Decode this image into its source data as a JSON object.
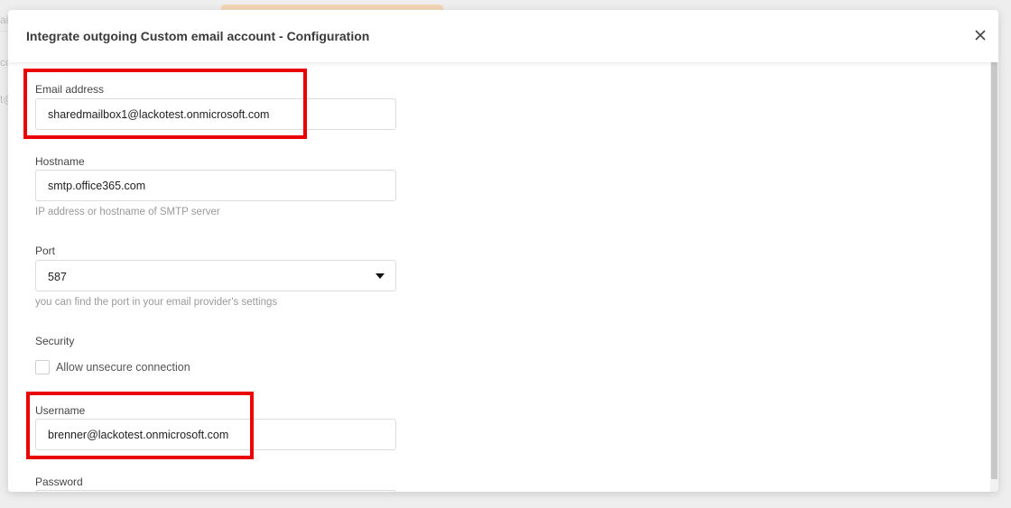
{
  "background": {
    "left_text_1": "ai",
    "left_text_2": "cc",
    "left_text_3": "t@"
  },
  "modal": {
    "title": "Integrate outgoing Custom email account - Configuration",
    "close_icon": "close-icon"
  },
  "form": {
    "email": {
      "label": "Email address",
      "value": "sharedmailbox1@lackotest.onmicrosoft.com"
    },
    "hostname": {
      "label": "Hostname",
      "value": "smtp.office365.com",
      "hint": "IP address or hostname of SMTP server"
    },
    "port": {
      "label": "Port",
      "value": "587",
      "hint": "you can find the port in your email provider's settings"
    },
    "security": {
      "label": "Security",
      "checkbox_label": "Allow unsecure connection",
      "checked": false
    },
    "username": {
      "label": "Username",
      "value": "brenner@lackotest.onmicrosoft.com"
    },
    "password": {
      "label": "Password"
    }
  },
  "colors": {
    "highlight": "#ea0000",
    "accent_tab": "#f3d7b6"
  }
}
